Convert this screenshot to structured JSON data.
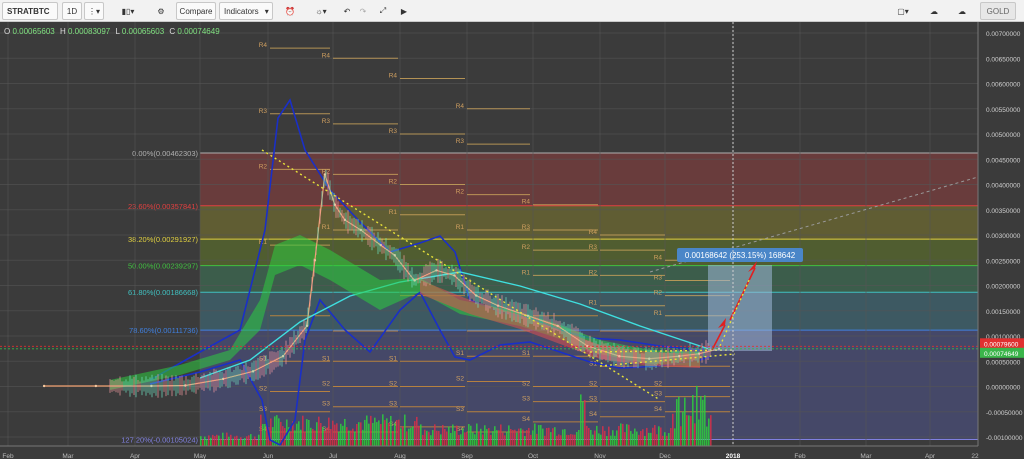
{
  "toolbar": {
    "symbol": "STRATBTC",
    "interval": "1D",
    "compare_label": "Compare",
    "indicators_label": "Indicators",
    "plan_label": "GOLD"
  },
  "legend_ohlc": {
    "o_label": "O",
    "o_value": "0.00065603",
    "h_label": "H",
    "h_value": "0.00083097",
    "l_label": "L",
    "l_value": "0.00065603",
    "c_label": "C",
    "c_value": "0.00074649"
  },
  "colors": {
    "background": "#3b3b3b",
    "bollinger": "#1a2fc7",
    "sma": "#3fe0e0",
    "ribbon": "#2ecc40",
    "fib_trend": "#e8e23a",
    "projection_arrow": "#e02020",
    "price_badge_red": "#e03030",
    "price_badge_green": "#3ab54a"
  },
  "chart_data": {
    "type": "line",
    "title": "",
    "x_tick_labels": [
      "Feb",
      "Mar",
      "Apr",
      "May",
      "Jun",
      "Jul",
      "Aug",
      "Sep",
      "Oct",
      "Nov",
      "Dec",
      "2018",
      "Feb",
      "Mar",
      "Apr",
      "22"
    ],
    "y_tick_labels": [
      "0.00700000",
      "0.00650000",
      "0.00600000",
      "0.00550000",
      "0.00500000",
      "0.00450000",
      "0.00400000",
      "0.00350000",
      "0.00300000",
      "0.00250000",
      "0.00200000",
      "0.00150000",
      "0.00100000",
      "0.00050000",
      "0.00000000",
      "-0.00050000",
      "-0.00100000"
    ],
    "ylim": [
      -0.00115,
      0.0072
    ],
    "grid": true,
    "series": [
      {
        "name": "",
        "x": [
          "2017-01-20",
          "2017-02-15",
          "2017-03-15",
          "2017-04-01",
          "2017-04-20",
          "2017-05-05",
          "2017-05-20",
          "2017-06-01",
          "2017-06-05",
          "2017-06-10",
          "2017-06-15",
          "2017-06-20",
          "2017-06-28",
          "2017-07-08",
          "2017-07-15",
          "2017-07-25",
          "2017-08-05",
          "2017-08-14",
          "2017-08-25",
          "2017-09-05",
          "2017-09-20",
          "2017-10-05",
          "2017-10-20",
          "2017-11-05",
          "2017-11-20",
          "2017-12-05",
          "2017-12-15",
          "2017-12-25"
        ],
        "values": [
          1e-05,
          1e-05,
          1e-05,
          2e-05,
          0.00015,
          0.0003,
          0.0006,
          0.0012,
          0.0025,
          0.0042,
          0.0036,
          0.0033,
          0.0031,
          0.0028,
          0.0026,
          0.0021,
          0.0023,
          0.0022,
          0.0018,
          0.0016,
          0.0014,
          0.0012,
          0.0008,
          0.0006,
          0.00055,
          0.0006,
          0.00065,
          0.00074649
        ]
      }
    ],
    "fibonacci_levels": [
      {
        "label": "0.00%(0.00462303)",
        "value": 0.00462303,
        "color": "#b0b0b0"
      },
      {
        "label": "23.60%(0.00357841)",
        "value": 0.00357841,
        "color": "#e04040"
      },
      {
        "label": "38.20%(0.00291927)",
        "value": 0.00291927,
        "color": "#e0d040"
      },
      {
        "label": "50.00%(0.00239297)",
        "value": 0.00239297,
        "color": "#40c040"
      },
      {
        "label": "61.80%(0.00186668)",
        "value": 0.00186668,
        "color": "#40c0c0"
      },
      {
        "label": "78.60%(0.00111736)",
        "value": 0.00111736,
        "color": "#4080e0"
      },
      {
        "label": "127.20%(-0.00105024)",
        "value": -0.00105024,
        "color": "#8080e0"
      }
    ],
    "pivot_labels": [
      "R4",
      "R3",
      "R2",
      "R1",
      "S1",
      "S2",
      "S3",
      "S4",
      "S5",
      "R5",
      "S5",
      "R6"
    ],
    "measure_label": "0.00168642 (253.15%) 168642",
    "price_badges": [
      {
        "value": "0.00079600",
        "color": "#e03030"
      },
      {
        "value": "0.00074649",
        "color": "#3ab54a"
      }
    ]
  }
}
